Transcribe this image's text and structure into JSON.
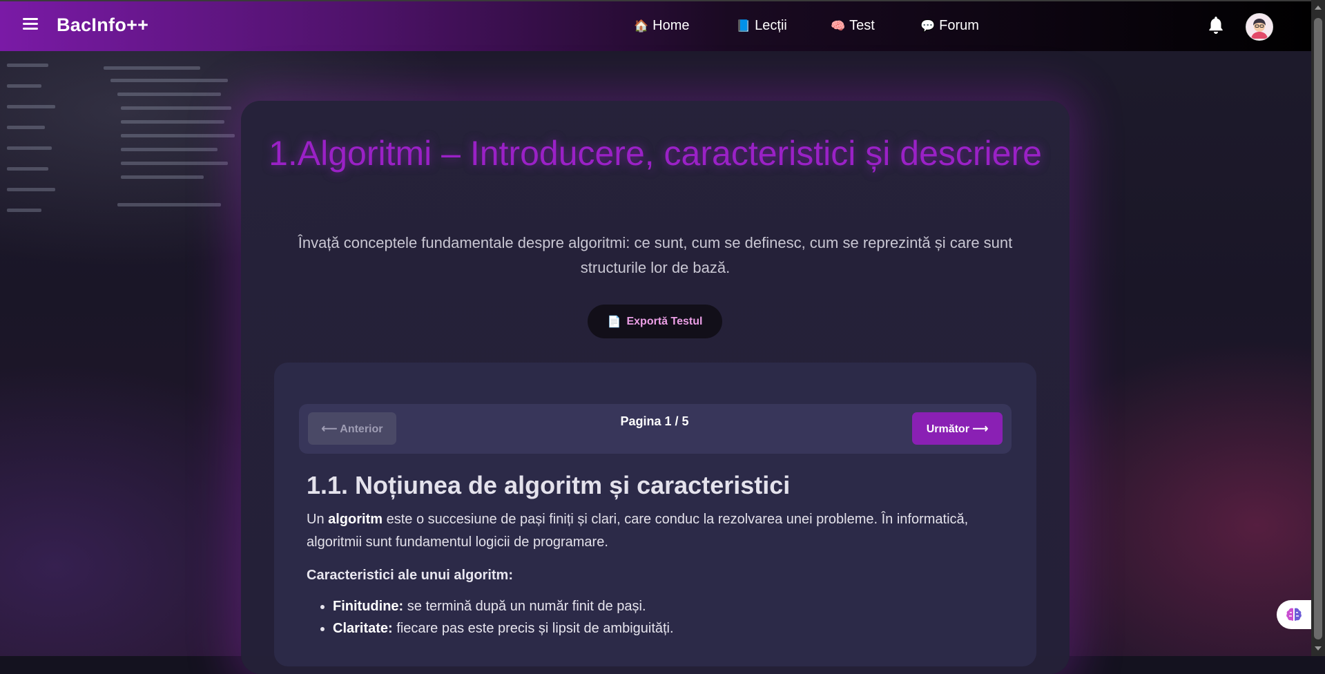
{
  "navbar": {
    "brand": "BacInfo++",
    "links": [
      {
        "icon": "🏠",
        "label": "Home"
      },
      {
        "icon": "📘",
        "label": "Lecții"
      },
      {
        "icon": "🧠",
        "label": "Test"
      },
      {
        "icon": "💬",
        "label": "Forum"
      }
    ]
  },
  "lesson": {
    "title": "1.Algoritmi – Introducere, caracteristici și descriere",
    "subtitle": "Învață conceptele fundamentale despre algoritmi: ce sunt, cum se definesc, cum se reprezintă și care sunt structurile lor de bază.",
    "export_icon": "📄",
    "export_label": "Exportă Testul"
  },
  "pager": {
    "prev_label": "⟵ Anterior",
    "page_info": "Pagina 1 / 5",
    "next_label": "Următor ⟶"
  },
  "section": {
    "title": "1.1. Noțiunea de algoritm și caracteristici",
    "intro_prefix": "Un ",
    "intro_bold": "algoritm",
    "intro_rest": " este o succesiune de pași finiți și clari, care conduc la rezolvarea unei probleme. În informatică, algoritmii sunt fundamentul logicii de programare.",
    "features_heading": "Caracteristici ale unui algoritm:",
    "features": [
      {
        "term": "Finitudine:",
        "desc": " se termină după un număr finit de pași."
      },
      {
        "term": "Claritate:",
        "desc": " fiecare pas este precis și lipsit de ambiguități."
      }
    ]
  },
  "colors": {
    "accent": "#9a21c6",
    "next_button": "#8a20b4",
    "export_text": "#ec9fe6"
  }
}
